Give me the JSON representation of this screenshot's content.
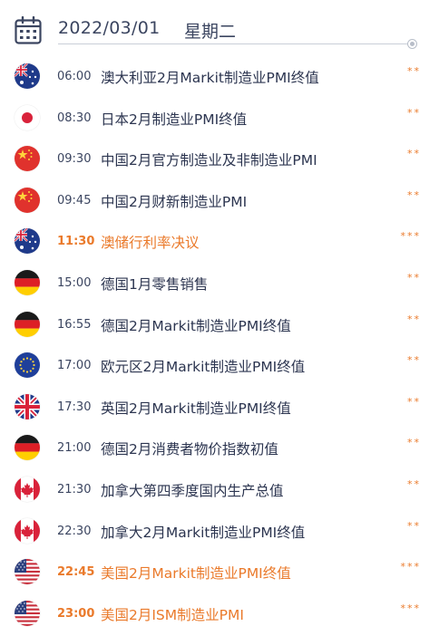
{
  "header": {
    "date": "2022/03/01",
    "weekday": "星期二"
  },
  "accent_color": "#ea7a2b",
  "events": [
    {
      "flag": "australia-flag-icon",
      "time": "06:00",
      "title": "澳大利亚2月Markit制造业PMI终值",
      "stars": "**",
      "highlight": false
    },
    {
      "flag": "japan-flag-icon",
      "time": "08:30",
      "title": "日本2月制造业PMI终值",
      "stars": "**",
      "highlight": false
    },
    {
      "flag": "china-flag-icon",
      "time": "09:30",
      "title": "中国2月官方制造业及非制造业PMI",
      "stars": "**",
      "highlight": false
    },
    {
      "flag": "china-flag-icon",
      "time": "09:45",
      "title": "中国2月财新制造业PMI",
      "stars": "**",
      "highlight": false
    },
    {
      "flag": "australia-flag-icon",
      "time": "11:30",
      "title": "澳储行利率决议",
      "stars": "***",
      "highlight": true
    },
    {
      "flag": "germany-flag-icon",
      "time": "15:00",
      "title": "德国1月零售销售",
      "stars": "**",
      "highlight": false
    },
    {
      "flag": "germany-flag-icon",
      "time": "16:55",
      "title": "德国2月Markit制造业PMI终值",
      "stars": "**",
      "highlight": false
    },
    {
      "flag": "eu-flag-icon",
      "time": "17:00",
      "title": "欧元区2月Markit制造业PMI终值",
      "stars": "**",
      "highlight": false
    },
    {
      "flag": "uk-flag-icon",
      "time": "17:30",
      "title": "英国2月Markit制造业PMI终值",
      "stars": "**",
      "highlight": false
    },
    {
      "flag": "germany-flag-icon",
      "time": "21:00",
      "title": "德国2月消费者物价指数初值",
      "stars": "**",
      "highlight": false
    },
    {
      "flag": "canada-flag-icon",
      "time": "21:30",
      "title": "加拿大第四季度国内生产总值",
      "stars": "**",
      "highlight": false
    },
    {
      "flag": "canada-flag-icon",
      "time": "22:30",
      "title": "加拿大2月Markit制造业PMI终值",
      "stars": "**",
      "highlight": false
    },
    {
      "flag": "usa-flag-icon",
      "time": "22:45",
      "title": "美国2月Markit制造业PMI终值",
      "stars": "***",
      "highlight": true
    },
    {
      "flag": "usa-flag-icon",
      "time": "23:00",
      "title": "美国2月ISM制造业PMI",
      "stars": "***",
      "highlight": true
    }
  ]
}
